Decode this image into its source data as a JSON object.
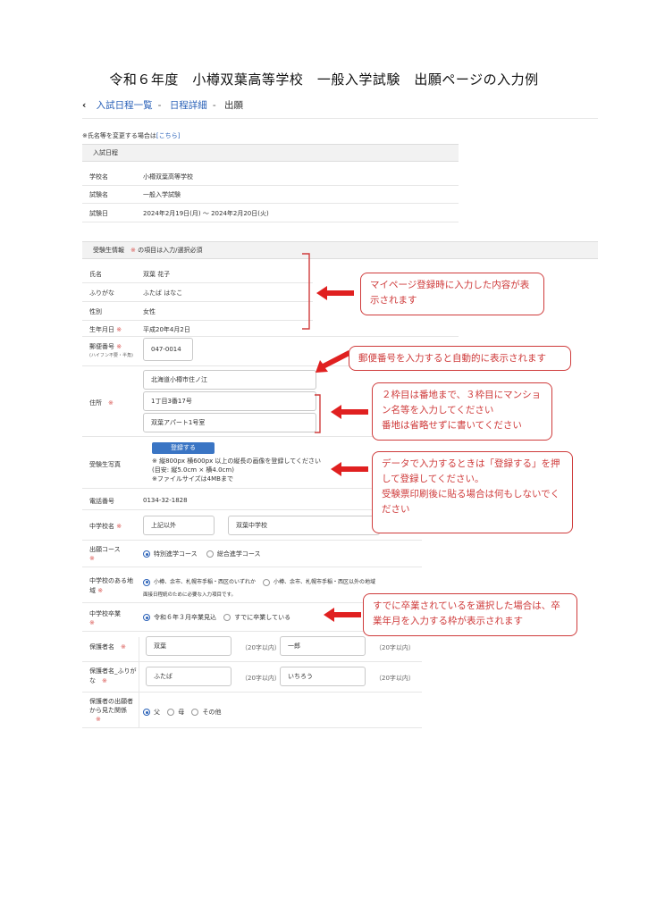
{
  "title": "令和６年度　小樽双葉高等学校　一般入学試験　出願ページの入力例",
  "breadcrumb": {
    "item1": "入試日程一覧",
    "item2": "日程詳細",
    "item3": "出願"
  },
  "name_change_note": "※氏名等を変更する場合は",
  "name_change_link": "[こちら]",
  "schedule": {
    "header": "入試日程",
    "rows": [
      {
        "label": "学校名",
        "value": "小樽双葉高等学校"
      },
      {
        "label": "試験名",
        "value": "一般入学試験"
      },
      {
        "label": "試験日",
        "value": "2024年2月19日(月) 〜 2024年2月20日(火)"
      }
    ]
  },
  "applicant": {
    "header": "受験生情報",
    "header_note": "の項目は入力/選択必須",
    "name_label": "氏名",
    "name_value": "双葉 花子",
    "kana_label": "ふりがな",
    "kana_value": "ふたば はなこ",
    "gender_label": "性別",
    "gender_value": "女性",
    "birth_label": "生年月日",
    "birth_value": "平成20年4月2日",
    "postal_label": "郵便番号",
    "postal_sub": "(ハイフン不要・半角)",
    "postal_value": "047-0014",
    "address_label": "住所",
    "address1": "北海道小樽市住ノ江",
    "address2": "1丁目3番17号",
    "address3": "双葉アパート1号室",
    "photo_label": "受験生写真",
    "photo_button": "登録する",
    "photo_note1": "※ 縦800px 横600px 以上の縦長の画像を登録してください",
    "photo_note2": "(目安: 縦5.0cm × 横4.0cm)",
    "photo_note3": "※ファイルサイズは4MBまで",
    "phone_label": "電話番号",
    "phone_value": "0134-32-1828",
    "jhs_label": "中学校名",
    "jhs_select": "上記以外",
    "jhs_value": "双葉中学校",
    "course_label": "出願コース",
    "course_opt1": "特別進学コース",
    "course_opt2": "総合進学コース",
    "area_label": "中学校のある地域",
    "area_opt1": "小樽、余市、札幌市手稲・西区のいずれか",
    "area_opt2": "小樽、余市、札幌市手稲・西区以外の地域",
    "area_note": "面接日程統のために必要な入力項目です。",
    "grad_label": "中学校卒業",
    "grad_opt1": "令和６年３月卒業見込",
    "grad_opt2": "すでに卒業している",
    "guardian_label": "保護者名",
    "guardian_last": "双葉",
    "guardian_first": "一郎",
    "limit20": "（20字以内）",
    "guardian_kana_label": "保護者名_ふりがな",
    "guardian_kana_last": "ふたば",
    "guardian_kana_first": "いちろう",
    "relation_label": "保護者の出願者から見た関係",
    "rel1": "父",
    "rel2": "母",
    "rel3": "その他"
  },
  "callouts": {
    "c1": "マイページ登録時に入力した内容が表示されます",
    "c2": "郵便番号を入力すると自動的に表示されます",
    "c3a": "２枠目は番地まで、３枠目にマンション名等を入力してください",
    "c3b": "番地は省略せずに書いてください",
    "c4a": "データで入力するときは「登録する」を押して登録してください。",
    "c4b": "受験票印刷後に貼る場合は何もしないでください",
    "c5": "すでに卒業されているを選択した場合は、卒業年月を入力する枠が表示されます"
  },
  "colors": {
    "accent": "#cf3b3b",
    "link": "#2b62b8",
    "button": "#3a75c4"
  }
}
